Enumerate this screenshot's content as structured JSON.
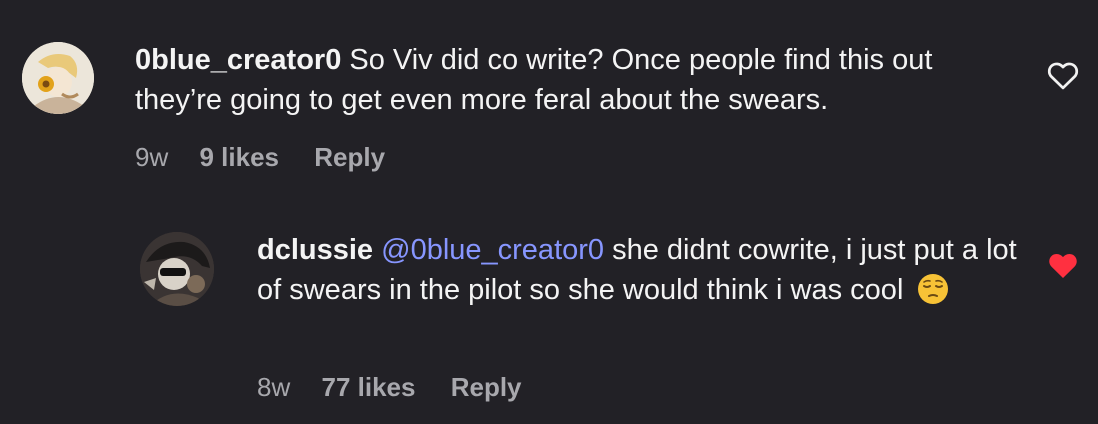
{
  "comments": [
    {
      "username": "0blue_creator0",
      "text": "So Viv did co write? Once people find this out they’re going to get even more feral about the swears.",
      "age": "9w",
      "likes": "9 likes",
      "reply_label": "Reply",
      "liked": false
    },
    {
      "username": "dclussie",
      "mention": "@0blue_creator0",
      "text": "she didnt cowrite, i just put a lot of swears in the pilot so she would think i was cool",
      "emoji": "pensive-face-emoji",
      "age": "8w",
      "likes": "77 likes",
      "reply_label": "Reply",
      "liked": true
    }
  ],
  "colors": {
    "background": "#222126",
    "mention": "#8796ff",
    "liked_heart": "#ff3040",
    "meta_text": "#a8a8ad"
  }
}
